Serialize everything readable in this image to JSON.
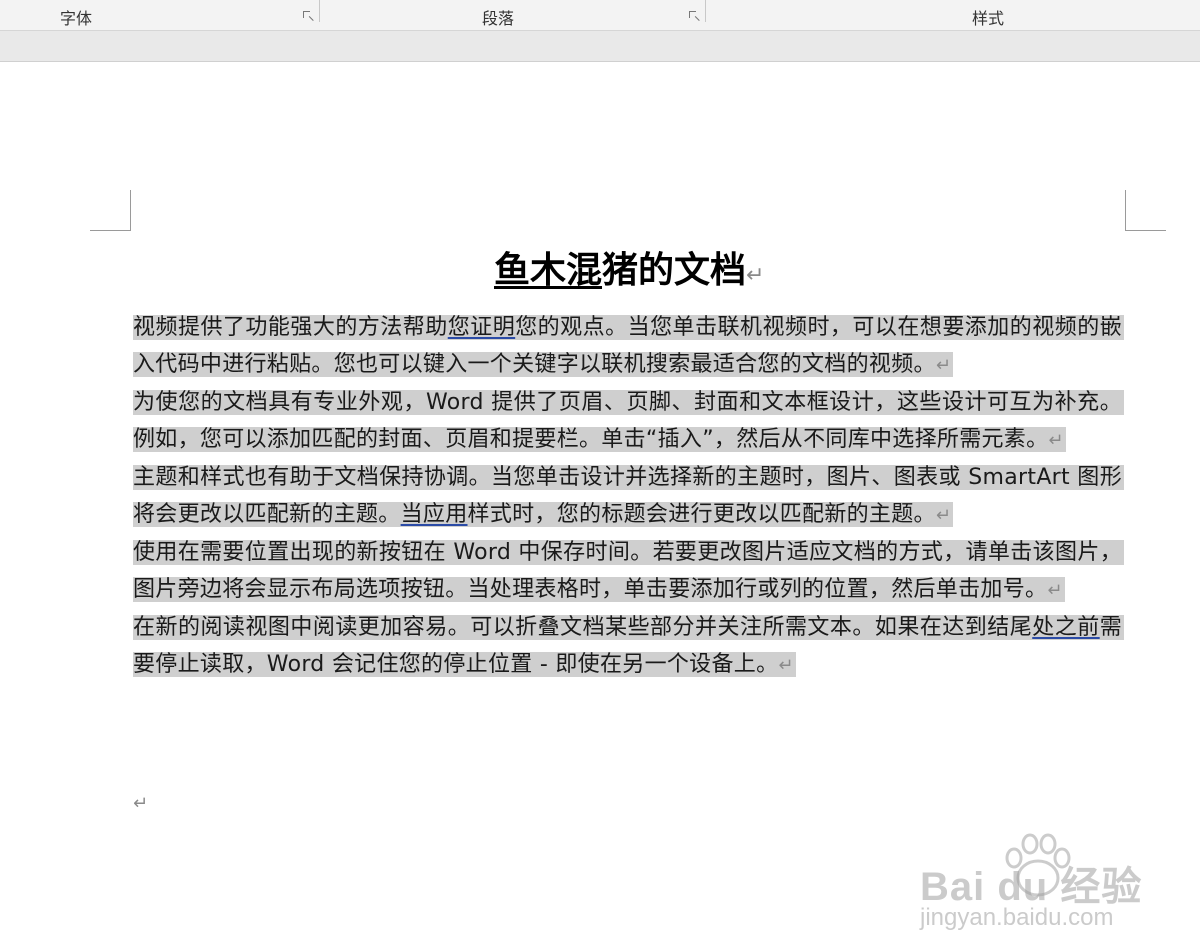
{
  "ribbon": {
    "groups": [
      {
        "label": "字体"
      },
      {
        "label": "段落"
      },
      {
        "label": "样式"
      }
    ]
  },
  "document": {
    "title_part1": "鱼木混",
    "title_part2": "猪的文档",
    "title_mark": "↵",
    "paragraphs": [
      {
        "before": "视频提供了功能强大的方法帮助",
        "link": "您证明",
        "after": "您的观点。当您单击联机视频时，可以在想要添加的视频的嵌入代码中进行粘贴。您也可以键入一个关键字以联机搜索最适合您的文档的视频。",
        "mark": "↵"
      },
      {
        "before": "为使您的文档具有专业外观，Word 提供了页眉、页脚、封面和文本框设计，这些设计可互为补充。例如，您可以添加匹配的封面、页眉和提要栏。单击“插入”，然后从不同库中选择所需元素。",
        "link": "",
        "after": "",
        "mark": "↵"
      },
      {
        "before": "主题和样式也有助于文档保持协调。当您单击设计并选择新的主题时，图片、图表或 SmartArt 图形将会更改以匹配新的主题。",
        "link": "当应用",
        "after": "样式时，您的标题会进行更改以匹配新的主题。",
        "mark": "↵"
      },
      {
        "before": "使用在需要位置出现的新按钮在 Word 中保存时间。若要更改图片适应文档的方式，请单击该图片，图片旁边将会显示布局选项按钮。当处理表格时，单击要添加行或列的位置，然后单击加号。",
        "link": "",
        "after": "",
        "mark": "↵"
      },
      {
        "before": "在新的阅读视图中阅读更加容易。可以折叠文档某些部分并关注所需文本。如果在达到结尾",
        "link": "处之前",
        "after": "需要停止读取，Word 会记住您的停止位置 - 即使在另一个设备上。",
        "mark": "↵"
      }
    ],
    "empty_mark": "↵"
  },
  "watermark": {
    "logo": "Bai du 经验",
    "sub": "jingyan.baidu.com"
  }
}
